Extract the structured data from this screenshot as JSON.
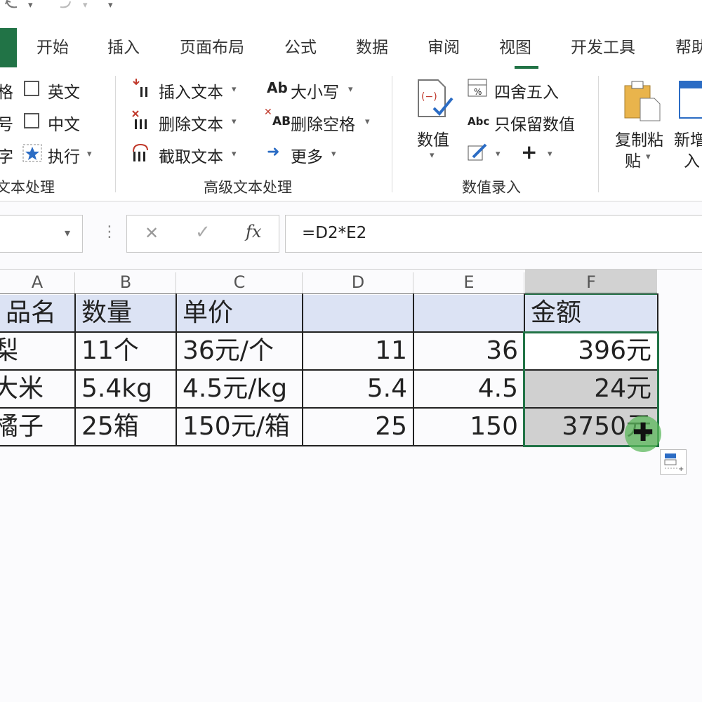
{
  "quick_access": {
    "undo_icon": "undo-icon",
    "redo_icon": "redo-icon",
    "more_icon": "customize-toolbar-icon"
  },
  "tabs": [
    "开始",
    "插入",
    "页面布局",
    "公式",
    "数据",
    "审阅",
    "视图",
    "开发工具",
    "帮助"
  ],
  "ribbon": {
    "group1": {
      "item1": "格",
      "item2": "号",
      "item3": "字",
      "check_en": "英文",
      "check_zh": "中文",
      "execute": "执行",
      "label": "文本处理"
    },
    "group2": {
      "insert_text": "插入文本",
      "delete_text": "删除文本",
      "extract_text": "截取文本",
      "case": "大小写",
      "remove_spaces": "删除空格",
      "more": "更多",
      "label": "高级文本处理",
      "ab_icon_text": "Ab",
      "abc_icon_text": "AB"
    },
    "group3": {
      "value_btn": "数值",
      "round": "四舍五入",
      "keep_values": "只保留数值",
      "label": "数值录入",
      "abc_prefix": "Abc",
      "plus": "+"
    },
    "group4": {
      "copy_paste": "复制粘贴",
      "copy_paste_line1": "复制粘",
      "copy_paste_line2": "贴",
      "new_insert_line1": "新增",
      "new_insert_line2": "入"
    }
  },
  "formula_bar": {
    "cancel": "✕",
    "enter": "✓",
    "fx": "fx",
    "formula": "=D2*E2",
    "dots": "⋮"
  },
  "columns": [
    "A",
    "B",
    "C",
    "D",
    "E",
    "F"
  ],
  "rows": [
    {
      "A": "品名",
      "B": "数量",
      "C": "单价",
      "D": "",
      "E": "",
      "F": "金额"
    },
    {
      "A": "梨",
      "B": "11个",
      "C": "36元/个",
      "D": "11",
      "E": "36",
      "F": "396元"
    },
    {
      "A": "大米",
      "B": "5.4kg",
      "C": "4.5元/kg",
      "D": "5.4",
      "E": "4.5",
      "F": "24元"
    },
    {
      "A": "橘子",
      "B": "25箱",
      "C": "150元/箱",
      "D": "25",
      "E": "150",
      "F": "3750元"
    }
  ],
  "colors": {
    "excel_green": "#217346",
    "header_fill": "#dce3f4",
    "selection_border": "#217346",
    "cursor_green": "#5cb85c"
  }
}
